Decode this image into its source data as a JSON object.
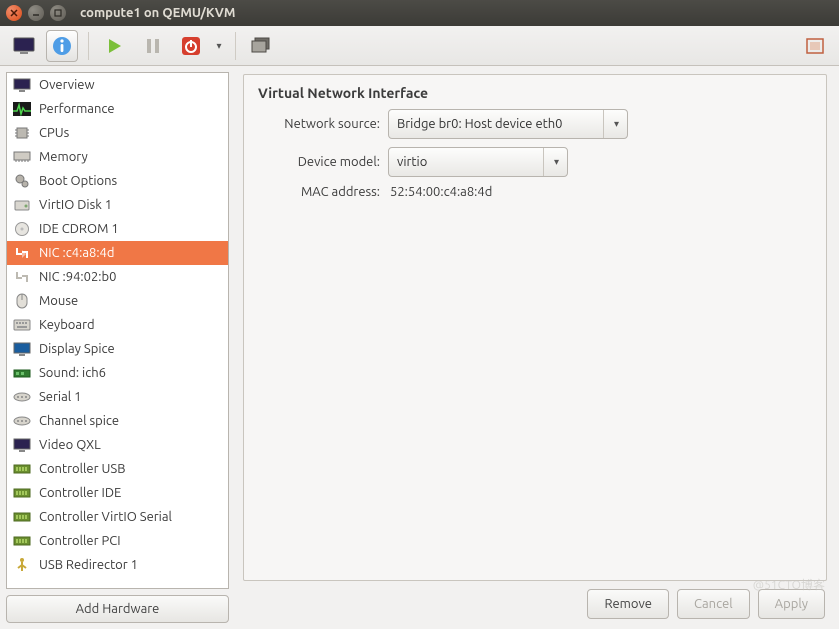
{
  "window": {
    "title": "compute1 on QEMU/KVM"
  },
  "toolbar": {
    "console_tip": "Console",
    "details_tip": "Details",
    "run_tip": "Run",
    "pause_tip": "Pause",
    "shutdown_tip": "Shut down",
    "snapshots_tip": "Snapshots",
    "fullscreen_tip": "Fullscreen"
  },
  "sidebar": {
    "items": [
      {
        "label": "Overview",
        "icon": "monitor-icon"
      },
      {
        "label": "Performance",
        "icon": "pulse-icon"
      },
      {
        "label": "CPUs",
        "icon": "cpu-icon"
      },
      {
        "label": "Memory",
        "icon": "memory-icon"
      },
      {
        "label": "Boot Options",
        "icon": "gears-icon"
      },
      {
        "label": "VirtIO Disk 1",
        "icon": "disk-icon"
      },
      {
        "label": "IDE CDROM 1",
        "icon": "cdrom-icon"
      },
      {
        "label": "NIC :c4:a8:4d",
        "icon": "nic-icon",
        "selected": true
      },
      {
        "label": "NIC :94:02:b0",
        "icon": "nic-icon"
      },
      {
        "label": "Mouse",
        "icon": "mouse-icon"
      },
      {
        "label": "Keyboard",
        "icon": "keyboard-icon"
      },
      {
        "label": "Display Spice",
        "icon": "display-icon"
      },
      {
        "label": "Sound: ich6",
        "icon": "sound-icon"
      },
      {
        "label": "Serial 1",
        "icon": "serial-icon"
      },
      {
        "label": "Channel spice",
        "icon": "serial-icon"
      },
      {
        "label": "Video QXL",
        "icon": "video-icon"
      },
      {
        "label": "Controller USB",
        "icon": "controller-icon"
      },
      {
        "label": "Controller IDE",
        "icon": "controller-icon"
      },
      {
        "label": "Controller VirtIO Serial",
        "icon": "controller-icon"
      },
      {
        "label": "Controller PCI",
        "icon": "controller-icon"
      },
      {
        "label": "USB Redirector 1",
        "icon": "usb-icon"
      }
    ],
    "add_hardware_label": "Add Hardware"
  },
  "detail": {
    "title": "Virtual Network Interface",
    "network_source_label": "Network source:",
    "network_source_value": "Bridge br0: Host device eth0",
    "device_model_label": "Device model:",
    "device_model_value": "virtio",
    "mac_label": "MAC address:",
    "mac_value": "52:54:00:c4:a8:4d"
  },
  "footer": {
    "remove": "Remove",
    "cancel": "Cancel",
    "apply": "Apply"
  },
  "watermark": "@51CTO博客"
}
